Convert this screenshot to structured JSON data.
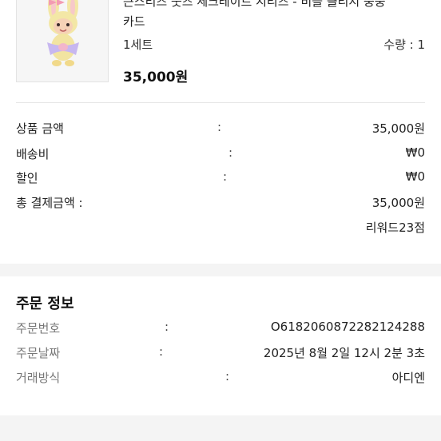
{
  "product": {
    "name_line1": "큰스티즈 숫즈 세크레이트 시리즈 - 비블 클리시 중중",
    "name_line2": "카드",
    "option": "1세트",
    "quantity": "수량 : 1",
    "price": "35,000원"
  },
  "summary": {
    "rows": [
      {
        "label": "상품 금액",
        "sep": ":",
        "value": "35,000원"
      },
      {
        "label": "배송비",
        "sep": ":",
        "value": "₩0"
      },
      {
        "label": "할인",
        "sep": ":",
        "value": "₩0"
      },
      {
        "label": "총 결제금액 :",
        "sep": "",
        "value": "35,000원"
      }
    ],
    "reward": "리워드23점"
  },
  "order_info": {
    "title": "주문 정보",
    "rows": [
      {
        "label": "주문번호",
        "sep": ":",
        "value": "O6182060872282124288"
      },
      {
        "label": "주문날짜",
        "sep": ":",
        "value": "2025년 8월 2일 12시 2분 3초"
      },
      {
        "label": "거래방식",
        "sep": ":",
        "value": "아디엔"
      }
    ]
  },
  "colors": {
    "divider": "#e6e6e6",
    "section_gap": "#f4f4f4"
  },
  "icons": [
    "plush-doll-image"
  ]
}
